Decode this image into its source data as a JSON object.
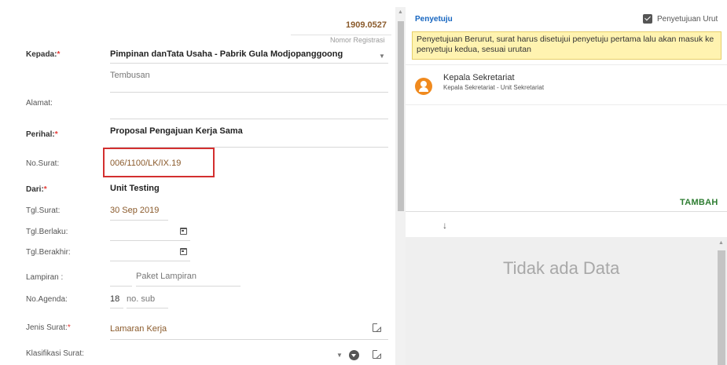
{
  "form": {
    "reg_number": "1909.0527",
    "reg_label": "Nomor Registrasi",
    "kepada_label": "Kepada:",
    "kepada_value": "Pimpinan danTata Usaha - Pabrik Gula Modjopanggoong",
    "tembusan": "Tembusan",
    "alamat_label": "Alamat:",
    "perihal_label": "Perihal:",
    "perihal_value": "Proposal Pengajuan Kerja Sama",
    "nosurat_label": "No.Surat:",
    "nosurat_value": "006/1100/LK/IX.19",
    "dari_label": "Dari:",
    "dari_value": "Unit Testing",
    "tglsurat_label": "Tgl.Surat:",
    "tglsurat_value": "30 Sep 2019",
    "tglberlaku_label": "Tgl.Berlaku:",
    "tglberakhir_label": "Tgl.Berakhir:",
    "lampiran_label": "Lampiran :",
    "lampiran_placeholder": "Paket Lampiran",
    "noagenda_label": "No.Agenda:",
    "noagenda_value": "18",
    "nosub_placeholder": "no. sub",
    "jenis_label": "Jenis Surat:",
    "jenis_value": "Lamaran Kerja",
    "klasifikasi_label": "Klasifikasi Surat:",
    "required_mark": "*"
  },
  "approval": {
    "title": "Penyetuju",
    "checkbox_label": "Penyetujuan Urut",
    "checkbox_checked": true,
    "notice": "Penyetujuan Berurut, surat harus disetujui penyetuju pertama lalu akan masuk ke penyetuju kedua, sesuai urutan",
    "approver_name": "Kepala Sekretariat",
    "approver_sub": "Kepala Sekretariat - Unit Sekretariat",
    "add_button": "TAMBAH",
    "empty_text": "Tidak ada Data"
  },
  "icons": {
    "down_arrow": "↓",
    "caret": "▼",
    "scroll_up": "▲"
  },
  "colors": {
    "accent_brown": "#8a5a2b",
    "link_blue": "#1565c0",
    "action_green": "#2e7d32",
    "notice_bg": "#fff3b0",
    "highlight_red": "#d32f2f",
    "avatar_orange": "#f08a1e"
  }
}
